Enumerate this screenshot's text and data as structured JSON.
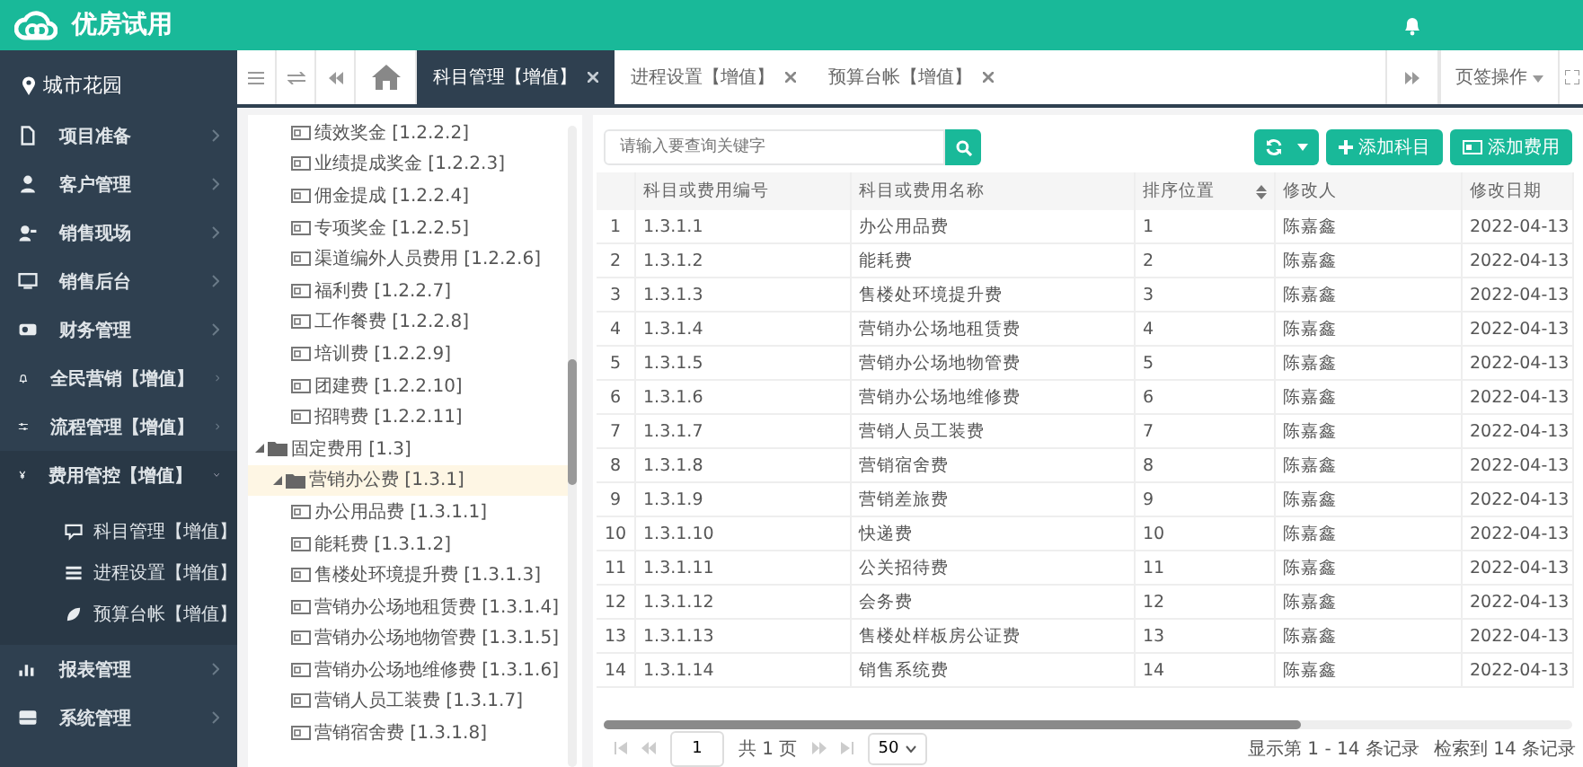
{
  "header": {
    "title": "优房试用"
  },
  "sidebar": {
    "location": "城市花园",
    "items": [
      {
        "label": "项目准备"
      },
      {
        "label": "客户管理"
      },
      {
        "label": "销售现场"
      },
      {
        "label": "销售后台"
      },
      {
        "label": "财务管理"
      },
      {
        "label": "全民营销【增值】"
      },
      {
        "label": "流程管理【增值】"
      },
      {
        "label": "费用管控【增值】",
        "expanded": true,
        "children": [
          {
            "label": "科目管理【增值】"
          },
          {
            "label": "进程设置【增值】"
          },
          {
            "label": "预算台帐【增值】"
          }
        ]
      },
      {
        "label": "报表管理"
      },
      {
        "label": "系统管理"
      }
    ]
  },
  "tabs": [
    {
      "label": "科目管理【增值】",
      "selected": true
    },
    {
      "label": "进程设置【增值】",
      "selected": false
    },
    {
      "label": "预算台帐【增值】",
      "selected": false
    }
  ],
  "tab_actions": {
    "label": "页签操作"
  },
  "tree": {
    "items": [
      {
        "kind": "leaf",
        "label": "绩效奖金 [1.2.2.2]"
      },
      {
        "kind": "leaf",
        "label": "业绩提成奖金 [1.2.2.3]"
      },
      {
        "kind": "leaf",
        "label": "佣金提成 [1.2.2.4]"
      },
      {
        "kind": "leaf",
        "label": "专项奖金 [1.2.2.5]"
      },
      {
        "kind": "leaf",
        "label": "渠道编外人员费用 [1.2.2.6]"
      },
      {
        "kind": "leaf",
        "label": "福利费 [1.2.2.7]"
      },
      {
        "kind": "leaf",
        "label": "工作餐费 [1.2.2.8]"
      },
      {
        "kind": "leaf",
        "label": "培训费 [1.2.2.9]"
      },
      {
        "kind": "leaf",
        "label": "团建费 [1.2.2.10]"
      },
      {
        "kind": "leaf",
        "label": "招聘费 [1.2.2.11]"
      },
      {
        "kind": "folder",
        "label": "固定费用 [1.3]",
        "selected": false,
        "expanded": true,
        "children": [
          {
            "kind": "folder",
            "label": "营销办公费 [1.3.1]",
            "selected": true,
            "expanded": true,
            "children": [
              {
                "kind": "leaf",
                "label": "办公用品费 [1.3.1.1]"
              },
              {
                "kind": "leaf",
                "label": "能耗费 [1.3.1.2]"
              },
              {
                "kind": "leaf",
                "label": "售楼处环境提升费 [1.3.1.3]"
              },
              {
                "kind": "leaf",
                "label": "营销办公场地租赁费 [1.3.1.4]"
              },
              {
                "kind": "leaf",
                "label": "营销办公场地物管费 [1.3.1.5]"
              },
              {
                "kind": "leaf",
                "label": "营销办公场地维修费 [1.3.1.6]"
              },
              {
                "kind": "leaf",
                "label": "营销人员工装费 [1.3.1.7]"
              },
              {
                "kind": "leaf",
                "label": "营销宿舍费 [1.3.1.8]"
              }
            ]
          }
        ]
      }
    ]
  },
  "search": {
    "placeholder": "请输入要查询关键字"
  },
  "buttons": [
    {
      "kind": "refresh"
    },
    {
      "kind": "add",
      "label": "添加科目"
    },
    {
      "kind": "card",
      "label": "添加费用"
    }
  ],
  "table": {
    "columns": [
      "",
      "科目或费用编号",
      "科目或费用名称",
      "排序位置",
      "修改人",
      "修改日期"
    ],
    "rows": [
      [
        "1",
        "1.3.1.1",
        "办公用品费",
        "1",
        "陈嘉鑫",
        "2022-04-13"
      ],
      [
        "2",
        "1.3.1.2",
        "能耗费",
        "2",
        "陈嘉鑫",
        "2022-04-13"
      ],
      [
        "3",
        "1.3.1.3",
        "售楼处环境提升费",
        "3",
        "陈嘉鑫",
        "2022-04-13"
      ],
      [
        "4",
        "1.3.1.4",
        "营销办公场地租赁费",
        "4",
        "陈嘉鑫",
        "2022-04-13"
      ],
      [
        "5",
        "1.3.1.5",
        "营销办公场地物管费",
        "5",
        "陈嘉鑫",
        "2022-04-13"
      ],
      [
        "6",
        "1.3.1.6",
        "营销办公场地维修费",
        "6",
        "陈嘉鑫",
        "2022-04-13"
      ],
      [
        "7",
        "1.3.1.7",
        "营销人员工装费",
        "7",
        "陈嘉鑫",
        "2022-04-13"
      ],
      [
        "8",
        "1.3.1.8",
        "营销宿舍费",
        "8",
        "陈嘉鑫",
        "2022-04-13"
      ],
      [
        "9",
        "1.3.1.9",
        "营销差旅费",
        "9",
        "陈嘉鑫",
        "2022-04-13"
      ],
      [
        "10",
        "1.3.1.10",
        "快递费",
        "10",
        "陈嘉鑫",
        "2022-04-13"
      ],
      [
        "11",
        "1.3.1.11",
        "公关招待费",
        "11",
        "陈嘉鑫",
        "2022-04-13"
      ],
      [
        "12",
        "1.3.1.12",
        "会务费",
        "12",
        "陈嘉鑫",
        "2022-04-13"
      ],
      [
        "13",
        "1.3.1.13",
        "售楼处样板房公证费",
        "13",
        "陈嘉鑫",
        "2022-04-13"
      ],
      [
        "14",
        "1.3.1.14",
        "销售系统费",
        "14",
        "陈嘉鑫",
        "2022-04-13"
      ]
    ]
  },
  "pagination": {
    "page": "1",
    "total_pages": "共 1 页",
    "page_size": "50",
    "showing": "显示第 1 - 14 条记录",
    "found": "检索到 14 条记录"
  }
}
